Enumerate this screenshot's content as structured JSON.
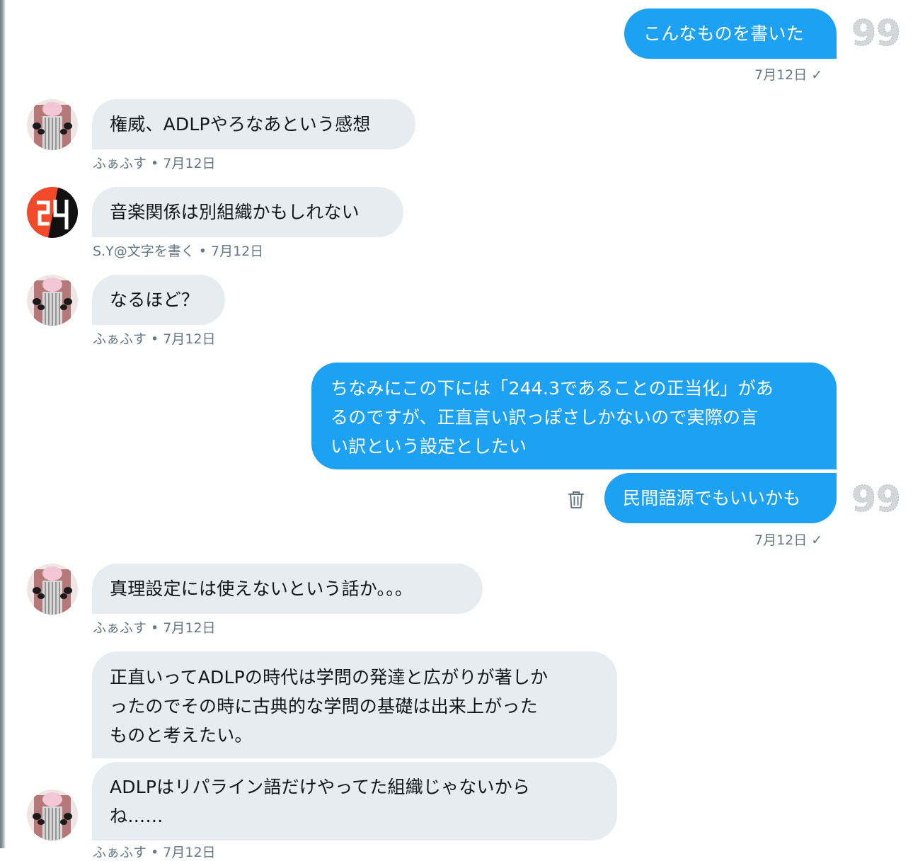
{
  "messages": [
    {
      "text": "こんなものを書いた",
      "meta": "7月12日 ✓"
    },
    {
      "text": "権威、ADLPやろなあという感想",
      "meta": "ふぁふす • 7月12日"
    },
    {
      "text": "音楽関係は別組織かもしれない",
      "meta": "S.Y@文字を書く • 7月12日"
    },
    {
      "text": "なるほど？",
      "meta": "ふぁふす • 7月12日"
    },
    {
      "lines": [
        "ちなみにこの下には「244.3であることの正当化」があ",
        "るのですが、正直言い訳っぽさしかないので実際の言",
        "い訳という設定としたい"
      ]
    },
    {
      "text": "民間語源でもいいかも",
      "meta": "7月12日 ✓"
    },
    {
      "text": "真理設定には使えないという話か。。。",
      "meta": "ふぁふす • 7月12日"
    },
    {
      "lines": [
        "正直いってADLPの時代は学問の発達と広がりが著しか",
        "ったのでその時に古典的な学問の基礎は出来上がった",
        "ものと考えたい。"
      ]
    },
    {
      "lines": [
        "ADLPはリパライン語だけやってた組織じゃないから",
        "ね……"
      ],
      "meta": "ふぁふす • 7月12日"
    }
  ],
  "badge_text": "99",
  "colors": {
    "outgoing_bubble": "#1da1f2",
    "incoming_bubble": "#e6ecf0",
    "meta_text": "#657786"
  }
}
